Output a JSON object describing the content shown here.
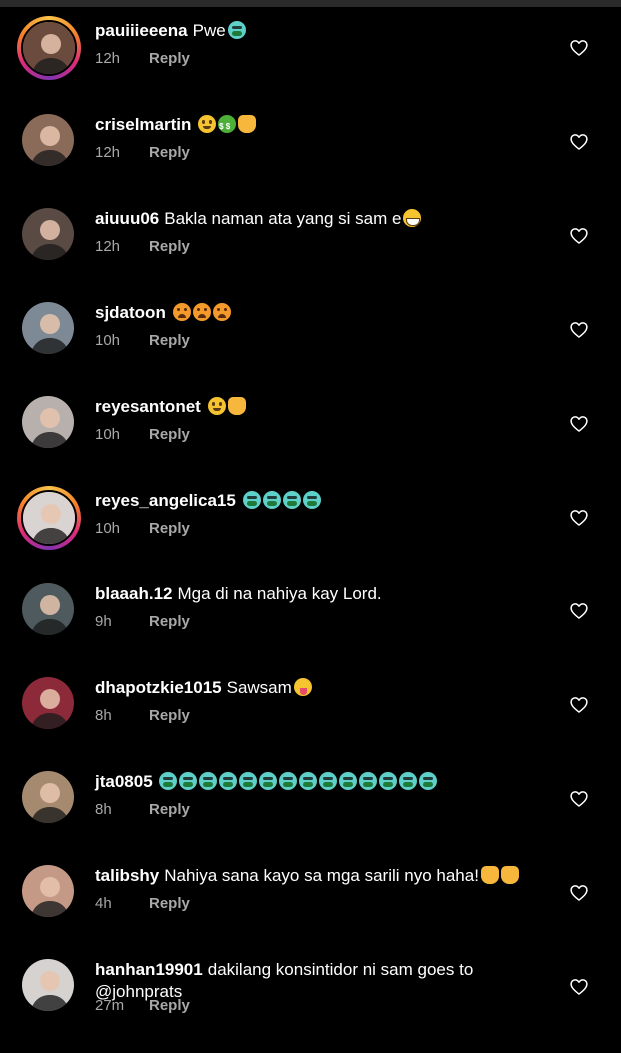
{
  "comments": [
    {
      "user": "pauiiieeena",
      "text": "Pwe",
      "time": "12h",
      "reply": "Reply",
      "ring": true,
      "emojis": [
        "sick"
      ],
      "avatar_color": "#6b4b3e"
    },
    {
      "user": "criselmartin",
      "text": "",
      "time": "12h",
      "reply": "Reply",
      "ring": false,
      "emojis": [
        "yellow",
        "money",
        "hand"
      ],
      "avatar_color": "#8a6a58"
    },
    {
      "user": "aiuuu06",
      "text": "Bakla naman ata yang si sam e",
      "time": "12h",
      "reply": "Reply",
      "ring": false,
      "emojis": [
        "laugh"
      ],
      "avatar_color": "#5a4a44"
    },
    {
      "user": "sjdatoon",
      "text": "",
      "time": "10h",
      "reply": "Reply",
      "ring": false,
      "emojis": [
        "orange",
        "orange",
        "orange"
      ],
      "avatar_color": "#7d8a96"
    },
    {
      "user": "reyesantonet",
      "text": "",
      "time": "10h",
      "reply": "Reply",
      "ring": false,
      "emojis": [
        "yellow",
        "hand"
      ],
      "avatar_color": "#b7b0ad"
    },
    {
      "user": "reyes_angelica15",
      "text": "",
      "time": "10h",
      "reply": "Reply",
      "ring": true,
      "emojis": [
        "sick",
        "sick",
        "sick",
        "sick"
      ],
      "avatar_color": "#d9d4d2"
    },
    {
      "user": "blaaah.12",
      "text": "Mga di na nahiya kay Lord.",
      "time": "9h",
      "reply": "Reply",
      "ring": false,
      "emojis": [],
      "avatar_color": "#4e5a5e"
    },
    {
      "user": "dhapotzkie1015",
      "text": "Sawsam",
      "time": "8h",
      "reply": "Reply",
      "ring": false,
      "emojis": [
        "tongue"
      ],
      "avatar_color": "#8c2a3a"
    },
    {
      "user": "jta0805",
      "text": "",
      "time": "8h",
      "reply": "Reply",
      "ring": false,
      "emojis": [
        "sick",
        "sick",
        "sick",
        "sick",
        "sick",
        "sick",
        "sick",
        "sick",
        "sick",
        "sick",
        "sick",
        "sick",
        "sick",
        "sick"
      ],
      "avatar_color": "#a58a70"
    },
    {
      "user": "talibshy",
      "text": "Nahiya sana kayo sa mga sarili nyo haha!",
      "time": "4h",
      "reply": "Reply",
      "ring": false,
      "emojis": [
        "hand",
        "hand"
      ],
      "avatar_color": "#c49a86"
    },
    {
      "user": "hanhan19901",
      "text": "dakilang konsintidor ni sam goes to @johnprats",
      "time": "27m",
      "reply": "Reply",
      "ring": false,
      "emojis": [],
      "avatar_color": "#d6d2cf"
    }
  ],
  "colors": {
    "background": "#000000",
    "text": "#ffffff",
    "meta": "#a8a8a8"
  }
}
